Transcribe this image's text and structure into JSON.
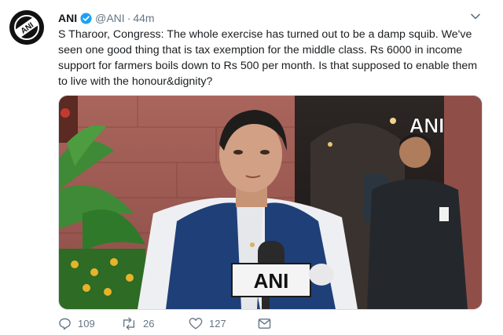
{
  "account": {
    "name": "ANI",
    "handle": "@ANI",
    "separator": "·",
    "time": "44m",
    "avatar_text": "ANI"
  },
  "tweet": {
    "text": "S Tharoor, Congress: The whole exercise has turned out to be a damp squib. We've seen one good thing that is tax exemption for the middle class. Rs 6000 in income support for farmers boils down to Rs 500 per month. Is that supposed to enable them to live with the honour&dignity?"
  },
  "media": {
    "watermark": "ANI",
    "mic_label": "ANI"
  },
  "actions": {
    "replies": "109",
    "retweets": "26",
    "likes": "127"
  },
  "colors": {
    "verified": "#1da1f2",
    "muted": "#657786",
    "vest": "#1f3f78"
  }
}
